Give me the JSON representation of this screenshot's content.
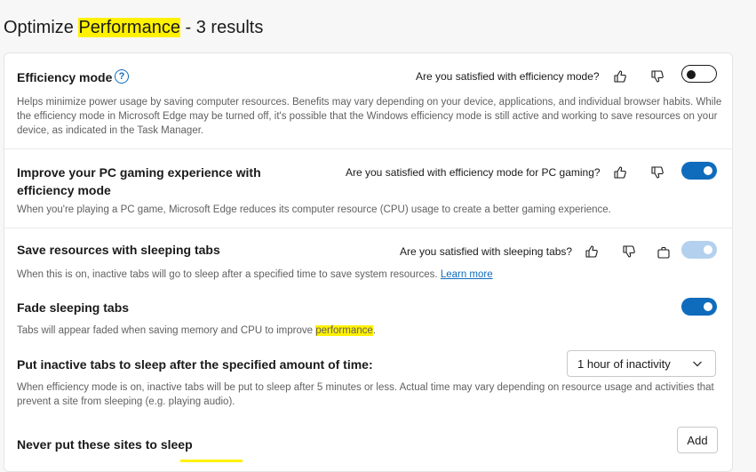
{
  "header": {
    "title_prefix": "Optimize ",
    "title_highlight": "Performance",
    "title_suffix": " - 3 results"
  },
  "efficiency": {
    "title": "Efficiency mode",
    "help_glyph": "?",
    "question": "Are you satisfied with efficiency mode?",
    "description": "Helps minimize power usage by saving computer resources. Benefits may vary depending on your device, applications, and individual browser habits. While the efficiency mode in Microsoft Edge may be turned off, it's possible that the Windows efficiency mode is still active and working to save resources on your device, as indicated in the Task Manager.",
    "enabled": false
  },
  "gaming": {
    "title": "Improve your PC gaming experience with efficiency mode",
    "question": "Are you satisfied with efficiency mode for PC gaming?",
    "description": "When you're playing a PC game, Microsoft Edge reduces its computer resource (CPU) usage to create a better gaming experience.",
    "enabled": true
  },
  "sleeping": {
    "title": "Save resources with sleeping tabs",
    "question": "Are you satisfied with sleeping tabs?",
    "description": "When this is on, inactive tabs will go to sleep after a specified time to save system resources. ",
    "learn_more": "Learn more",
    "enabled": true,
    "managed": true
  },
  "fade": {
    "title": "Fade sleeping tabs",
    "description_prefix": "Tabs will appear faded when saving memory and CPU to improve ",
    "description_highlight": "performance",
    "description_suffix": ".",
    "enabled": true
  },
  "inactive": {
    "title": "Put inactive tabs to sleep after the specified amount of time:",
    "selected": "1 hour of inactivity",
    "description": "When efficiency mode is on, inactive tabs will be put to sleep after 5 minutes or less. Actual time may vary depending on resource usage and activities that prevent a site from sleeping (e.g. playing audio)."
  },
  "never_sleep": {
    "title": "Never put these sites to sleep",
    "add_label": "Add"
  },
  "colors": {
    "accent": "#0f6cbd",
    "highlight": "#fff100",
    "toggle_disabled": "#b3d1ef"
  },
  "icons": [
    "help-icon",
    "thumbs-up-icon",
    "thumbs-down-icon",
    "managed-briefcase-icon",
    "chevron-down-icon"
  ]
}
